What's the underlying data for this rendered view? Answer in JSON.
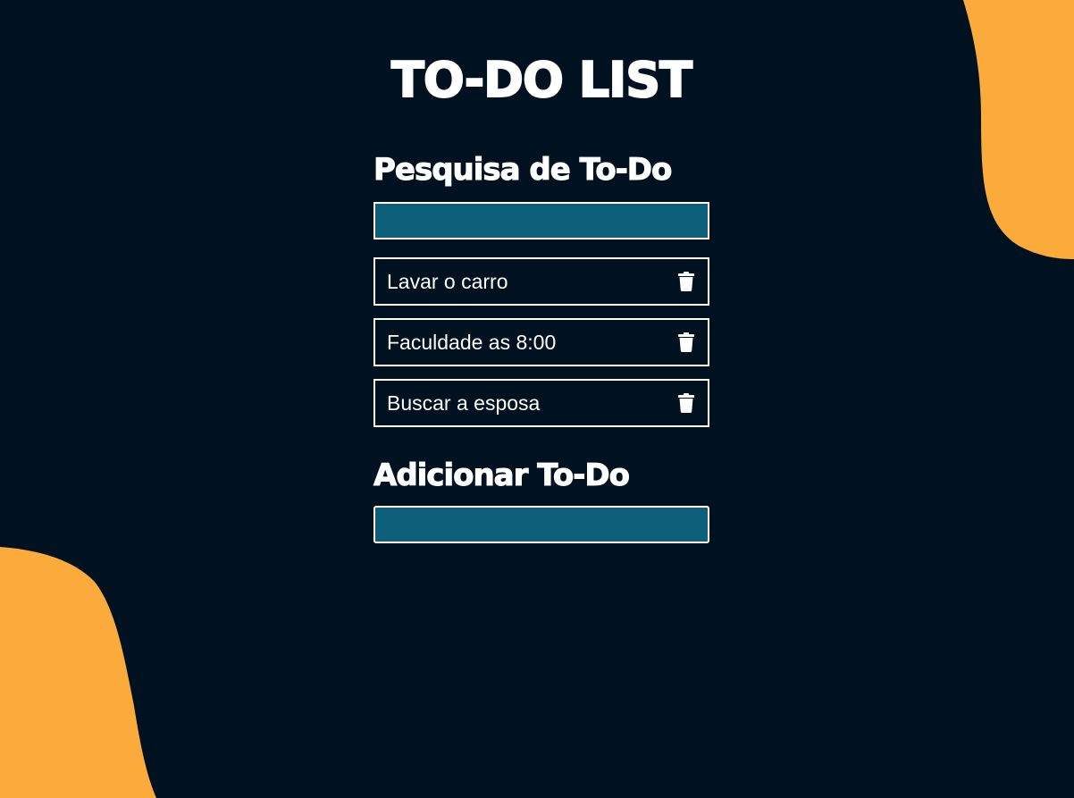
{
  "app": {
    "title": "TO-DO LIST"
  },
  "search": {
    "heading": "Pesquisa de To-Do",
    "value": "",
    "placeholder": ""
  },
  "todos": [
    {
      "text": "Lavar o carro",
      "icon": "trash-icon"
    },
    {
      "text": "Faculdade as 8:00",
      "icon": "trash-icon"
    },
    {
      "text": "Buscar a esposa",
      "icon": "trash-icon"
    }
  ],
  "add": {
    "heading": "Adicionar To-Do",
    "value": "",
    "placeholder": ""
  },
  "colors": {
    "background": "#001120",
    "accent_blob": "#fbab3c",
    "input_fill": "#0d5f7a",
    "text": "#ffffff"
  }
}
